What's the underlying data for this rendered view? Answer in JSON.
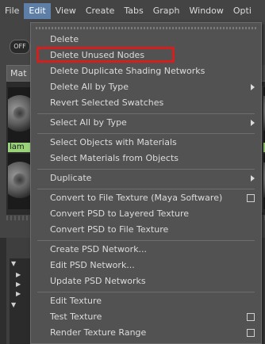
{
  "menubar": [
    "File",
    "Edit",
    "View",
    "Create",
    "Tabs",
    "Graph",
    "Window",
    "Opti"
  ],
  "active_menu": "Edit",
  "toolbar": {
    "toggle_label": "OFF"
  },
  "tabs": {
    "materials": "Mat"
  },
  "swatch": {
    "label": "lam"
  },
  "menu": {
    "items": [
      {
        "label": "Delete"
      },
      {
        "label": "Delete Unused Nodes",
        "highlighted": true
      },
      {
        "label": "Delete Duplicate Shading Networks"
      },
      {
        "label": "Delete All by Type",
        "submenu": true
      },
      {
        "label": "Revert Selected Swatches"
      },
      {
        "label": "Select All by Type",
        "submenu": true
      },
      {
        "label": "Select Objects with Materials"
      },
      {
        "label": "Select Materials from Objects"
      },
      {
        "label": "Duplicate",
        "submenu": true
      },
      {
        "label": "Convert to File Texture (Maya Software)",
        "option_box": true
      },
      {
        "label": "Convert PSD to Layered Texture"
      },
      {
        "label": "Convert PSD to File Texture"
      },
      {
        "label": "Create PSD Network..."
      },
      {
        "label": "Edit PSD Network..."
      },
      {
        "label": "Update PSD Networks"
      },
      {
        "label": "Edit Texture"
      },
      {
        "label": "Test Texture",
        "option_box": true
      },
      {
        "label": "Render Texture Range",
        "option_box": true
      }
    ]
  },
  "colors": {
    "highlight": "#d41f1f",
    "active_menu_bg": "#5d7ea6",
    "swatch_label_bg": "#9ad27a"
  }
}
